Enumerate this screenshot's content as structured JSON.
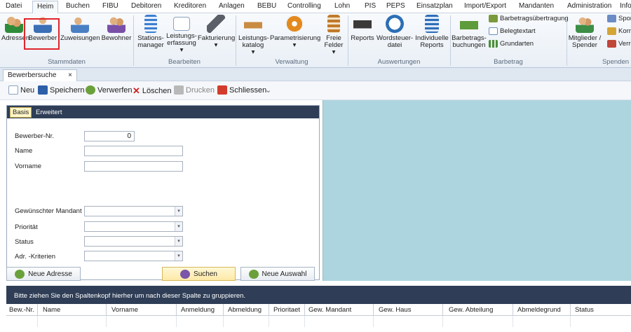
{
  "menu": {
    "tabs": [
      "Datei",
      "Heim",
      "Buchen",
      "FIBU",
      "Debitoren",
      "Kreditoren",
      "Anlagen",
      "BEBU",
      "Controlling",
      "Lohn",
      "PIS",
      "PEPS",
      "Einsatzplan",
      "Import/Export",
      "Mandanten",
      "Administration",
      "Info"
    ],
    "active": "Heim"
  },
  "ribbon": {
    "stammdaten": {
      "label": "Stammdaten",
      "adressen": "Adressen",
      "bewerber": "Bewerber",
      "zuweisungen": "Zuweisungen",
      "bewohner": "Bewohner"
    },
    "bearbeiten": {
      "label": "Bearbeiten",
      "stations_1": "Stations-",
      "stations_2": "manager",
      "leistungs_1": "Leistungs-",
      "leistungs_2": "erfassung",
      "fakturierung": "Fakturierung"
    },
    "verwaltung": {
      "label": "Verwaltung",
      "leistkat_1": "Leistungs-",
      "leistkat_2": "katalog",
      "param": "Parametrisierung",
      "freie_1": "Freie",
      "freie_2": "Felder"
    },
    "auswertungen": {
      "label": "Auswertungen",
      "reports": "Reports",
      "wordst_1": "Wordsteuer-",
      "wordst_2": "datei",
      "indiv_1": "Individuelle",
      "indiv_2": "Reports"
    },
    "barbetrag": {
      "label": "Barbetrag",
      "buch_1": "Barbetrags-",
      "buch_2": "buchungen",
      "uebertragung": "Barbetragsübertragung",
      "belegtext": "Belegtextart",
      "grundarten": "Grundarten"
    },
    "spenden": {
      "label": "Spenden",
      "mitglieder_1": "Mitglieder /",
      "mitglieder_2": "Spender",
      "spon": "Spon",
      "korr": "Korre",
      "verre": "Verre"
    }
  },
  "doc_tab": {
    "label": "Bewerbersuche",
    "close": "×"
  },
  "toolbar": {
    "neu": "Neu",
    "speichern": "Speichern",
    "verwerfen": "Verwerfen",
    "loeschen": "Löschen",
    "drucken": "Drucken",
    "schliessen": "Schliessen",
    "more": "⌄"
  },
  "form": {
    "tabs": {
      "basis": "Basis",
      "erweitert": "Erweitert"
    },
    "bewerber_nr_label": "Bewerber-Nr.",
    "bewerber_nr_value": "0",
    "name_label": "Name",
    "vorname_label": "Vorname",
    "mandant_label": "Gewünschter Mandant",
    "prioritaet_label": "Priorität",
    "status_label": "Status",
    "kriterien_label": "Adr. -Kriterien",
    "dd": "▾"
  },
  "buttons": {
    "neue_adresse": "Neue Adresse",
    "suchen": "Suchen",
    "neue_auswahl": "Neue Auswahl"
  },
  "grid": {
    "group_hint": "Bitte ziehen Sie den Spaltenkopf hierher um nach dieser Spalte zu gruppieren.",
    "columns": [
      "Bew.-Nr.",
      "Name",
      "Vorname",
      "Anmeldung",
      "Abmeldung",
      "Prioritaet",
      "Gew. Mandant",
      "Gew. Haus",
      "Gew. Abteilung",
      "Abmeldegrund",
      "Status"
    ]
  },
  "colors": {
    "accent": "#2f3e56",
    "highlight": "#e0242b",
    "preview_bg": "#add5e0"
  }
}
